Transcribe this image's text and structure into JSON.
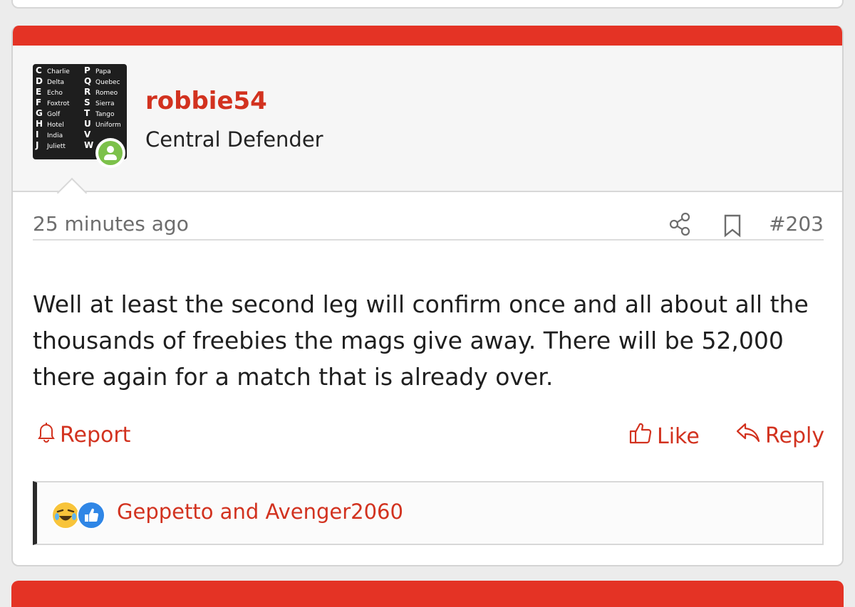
{
  "post": {
    "username": "robbie54",
    "user_title": "Central Defender",
    "timestamp": "25 minutes ago",
    "post_number": "#203",
    "content": "Well at least the second leg will confirm once and all about all the thousands of freebies the mags give away. There will be 52,000 there again for a match that is already over.",
    "actions": {
      "report": "Report",
      "like": "Like",
      "reply": "Reply"
    },
    "reactions": {
      "icons": [
        "laughing-emoji-icon",
        "thumbs-up-icon"
      ],
      "text": "Geppetto and Avenger2060"
    }
  },
  "avatar": {
    "left_column": [
      {
        "letter": "C",
        "word": "Charlie"
      },
      {
        "letter": "D",
        "word": "Delta"
      },
      {
        "letter": "E",
        "word": "Echo"
      },
      {
        "letter": "F",
        "word": "Foxtrot"
      },
      {
        "letter": "G",
        "word": "Golf"
      },
      {
        "letter": "H",
        "word": "Hotel"
      },
      {
        "letter": "I",
        "word": "India"
      },
      {
        "letter": "J",
        "word": "Juliett"
      }
    ],
    "right_column": [
      {
        "letter": "P",
        "word": "Papa"
      },
      {
        "letter": "Q",
        "word": "Quebec"
      },
      {
        "letter": "R",
        "word": "Romeo"
      },
      {
        "letter": "S",
        "word": "Sierra"
      },
      {
        "letter": "T",
        "word": "Tango"
      },
      {
        "letter": "U",
        "word": "Uniform"
      },
      {
        "letter": "V",
        "word": ""
      },
      {
        "letter": "W",
        "word": ""
      }
    ]
  },
  "colors": {
    "accent": "#e43325",
    "link": "#d2321f",
    "online": "#7cc14a",
    "like_blue": "#2f86e6"
  }
}
